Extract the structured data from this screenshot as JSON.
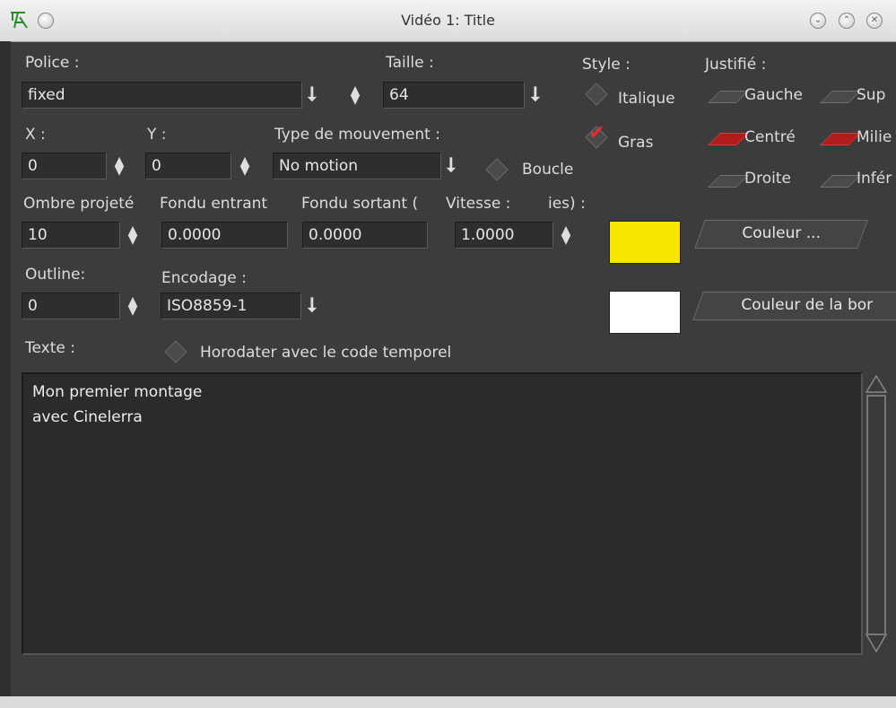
{
  "window": {
    "title": "Vidéo 1: Title",
    "app_icon": "cinelerra-logo",
    "controls": [
      "minimize-icon",
      "maximize-icon",
      "close-icon"
    ],
    "control_glyphs": [
      "⌄",
      "⌃",
      "✕"
    ]
  },
  "font": {
    "label": "Police :",
    "value": "fixed"
  },
  "size": {
    "label": "Taille :",
    "value": "64"
  },
  "style": {
    "label": "Style :",
    "italic_label": "Italique",
    "italic_checked": false,
    "bold_label": "Gras",
    "bold_checked": true
  },
  "justify": {
    "label": "Justifié :",
    "options": [
      {
        "label": "Gauche",
        "selected": false
      },
      {
        "label": "Sup",
        "selected": false
      },
      {
        "label": "Centré",
        "selected": true
      },
      {
        "label": "Milie",
        "selected": true
      },
      {
        "label": "Droite",
        "selected": false
      },
      {
        "label": "Infér",
        "selected": false
      }
    ]
  },
  "x": {
    "label": "X :",
    "value": "0"
  },
  "y": {
    "label": "Y :",
    "value": "0"
  },
  "motion": {
    "label": "Type de mouvement :",
    "value": "No motion",
    "loop_label": "Boucle",
    "loop_checked": false
  },
  "dropshadow": {
    "label": "Ombre projeté",
    "value": "10"
  },
  "fadein": {
    "label": "Fondu entrant",
    "value": "0.0000"
  },
  "fadeout": {
    "label": "Fondu sortant (",
    "value": "0.0000"
  },
  "speed": {
    "label": "Vitesse :",
    "value": "1.0000"
  },
  "seconds_label": "ies) :",
  "color": {
    "button": "Couleur ...",
    "swatch": "#f5e600"
  },
  "outline": {
    "label": "Outline:",
    "value": "0"
  },
  "encoding": {
    "label": "Encodage :",
    "value": "ISO8859-1"
  },
  "outline_color": {
    "button": "Couleur de la bor",
    "swatch": "#ffffff"
  },
  "text": {
    "label": "Texte :",
    "timecode_label": "Horodater avec le code temporel",
    "timecode_checked": false,
    "lines": [
      "Mon premier montage",
      "avec Cinelerra"
    ]
  },
  "glyphs": {
    "down_arrow": "⭣",
    "up": "▲",
    "down": "▼",
    "check": "✔"
  }
}
